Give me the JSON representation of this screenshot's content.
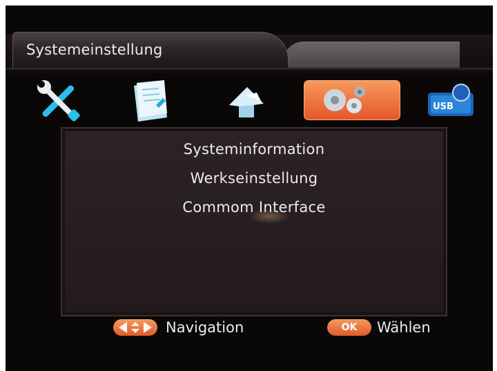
{
  "header": {
    "title": "Systemeinstellung"
  },
  "categories": [
    {
      "icon": "tools-icon",
      "selected": false
    },
    {
      "icon": "documents-icon",
      "selected": false
    },
    {
      "icon": "image-icon",
      "selected": false
    },
    {
      "icon": "system-gears-icon",
      "selected": true
    },
    {
      "icon": "usb-icon",
      "selected": false,
      "badge": "USB"
    }
  ],
  "menu": {
    "items": [
      {
        "label": "Systeminformation"
      },
      {
        "label": "Werkseinstellung"
      },
      {
        "label": "Commom Interface"
      }
    ]
  },
  "footer": {
    "nav_label": "Navigation",
    "ok_key": "OK",
    "ok_label": "Wählen"
  },
  "colors": {
    "accent": "#f0773f",
    "background": "#0a0707",
    "panel": "#282022",
    "text": "#ececec"
  }
}
